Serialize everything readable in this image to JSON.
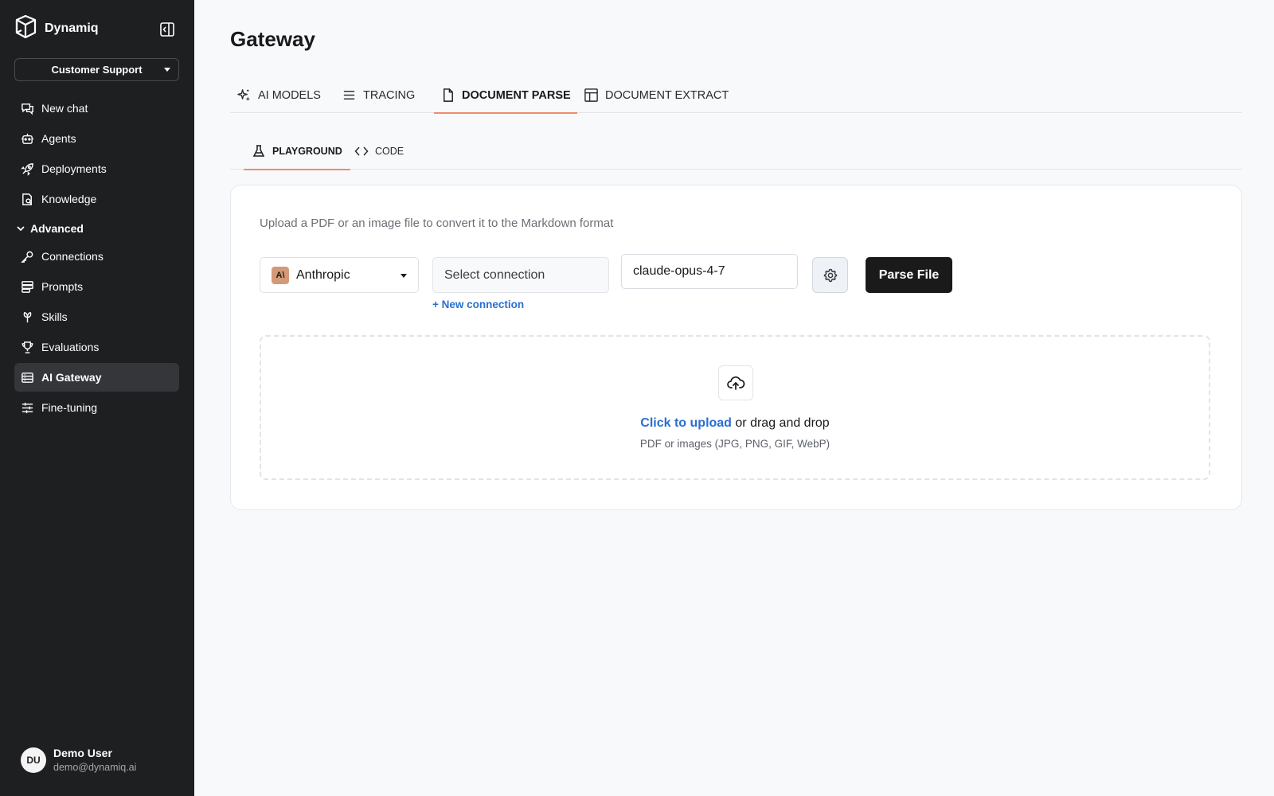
{
  "brand": {
    "name": "Dynamiq"
  },
  "workspace": {
    "selected": "Customer Support"
  },
  "sidebar": {
    "items_top": [
      {
        "label": "New chat",
        "icon": "chat-icon"
      },
      {
        "label": "Agents",
        "icon": "robot-icon"
      },
      {
        "label": "Deployments",
        "icon": "rocket-icon"
      },
      {
        "label": "Knowledge",
        "icon": "knowledge-icon"
      }
    ],
    "group_label": "Advanced",
    "items_advanced": [
      {
        "label": "Connections",
        "icon": "key-icon"
      },
      {
        "label": "Prompts",
        "icon": "prompts-icon"
      },
      {
        "label": "Skills",
        "icon": "skills-icon"
      },
      {
        "label": "Evaluations",
        "icon": "trophy-icon"
      },
      {
        "label": "AI Gateway",
        "icon": "gateway-icon",
        "active": true
      },
      {
        "label": "Fine-tuning",
        "icon": "sliders-icon"
      }
    ]
  },
  "user": {
    "initials": "DU",
    "name": "Demo User",
    "email": "demo@dynamiq.ai"
  },
  "page": {
    "title": "Gateway"
  },
  "tabs": [
    {
      "label": "AI MODELS",
      "icon": "sparkle-icon"
    },
    {
      "label": "TRACING",
      "icon": "list-icon"
    },
    {
      "label": "DOCUMENT PARSE",
      "icon": "document-icon",
      "active": true
    },
    {
      "label": "DOCUMENT EXTRACT",
      "icon": "table-icon"
    }
  ],
  "subtabs": [
    {
      "label": "PLAYGROUND",
      "icon": "flask-icon",
      "active": true
    },
    {
      "label": "CODE",
      "icon": "code-icon"
    }
  ],
  "parse": {
    "description": "Upload a PDF or an image file to convert it to the Markdown format",
    "provider": {
      "label": "Anthropic",
      "logo_text": "A\\",
      "logo_color": "#d49a77"
    },
    "connection_placeholder": "Select connection",
    "new_connection": "+ New connection",
    "model_value": "claude-opus-4-7",
    "parse_button": "Parse File",
    "upload": {
      "link": "Click to upload",
      "rest": " or drag and drop",
      "hint": "PDF or images (JPG, PNG, GIF, WebP)"
    }
  },
  "colors": {
    "accent": "#ef8c6d",
    "link": "#2a6fd1",
    "sidebar_bg": "#1e1f21",
    "primary_button": "#1a1a1a"
  }
}
